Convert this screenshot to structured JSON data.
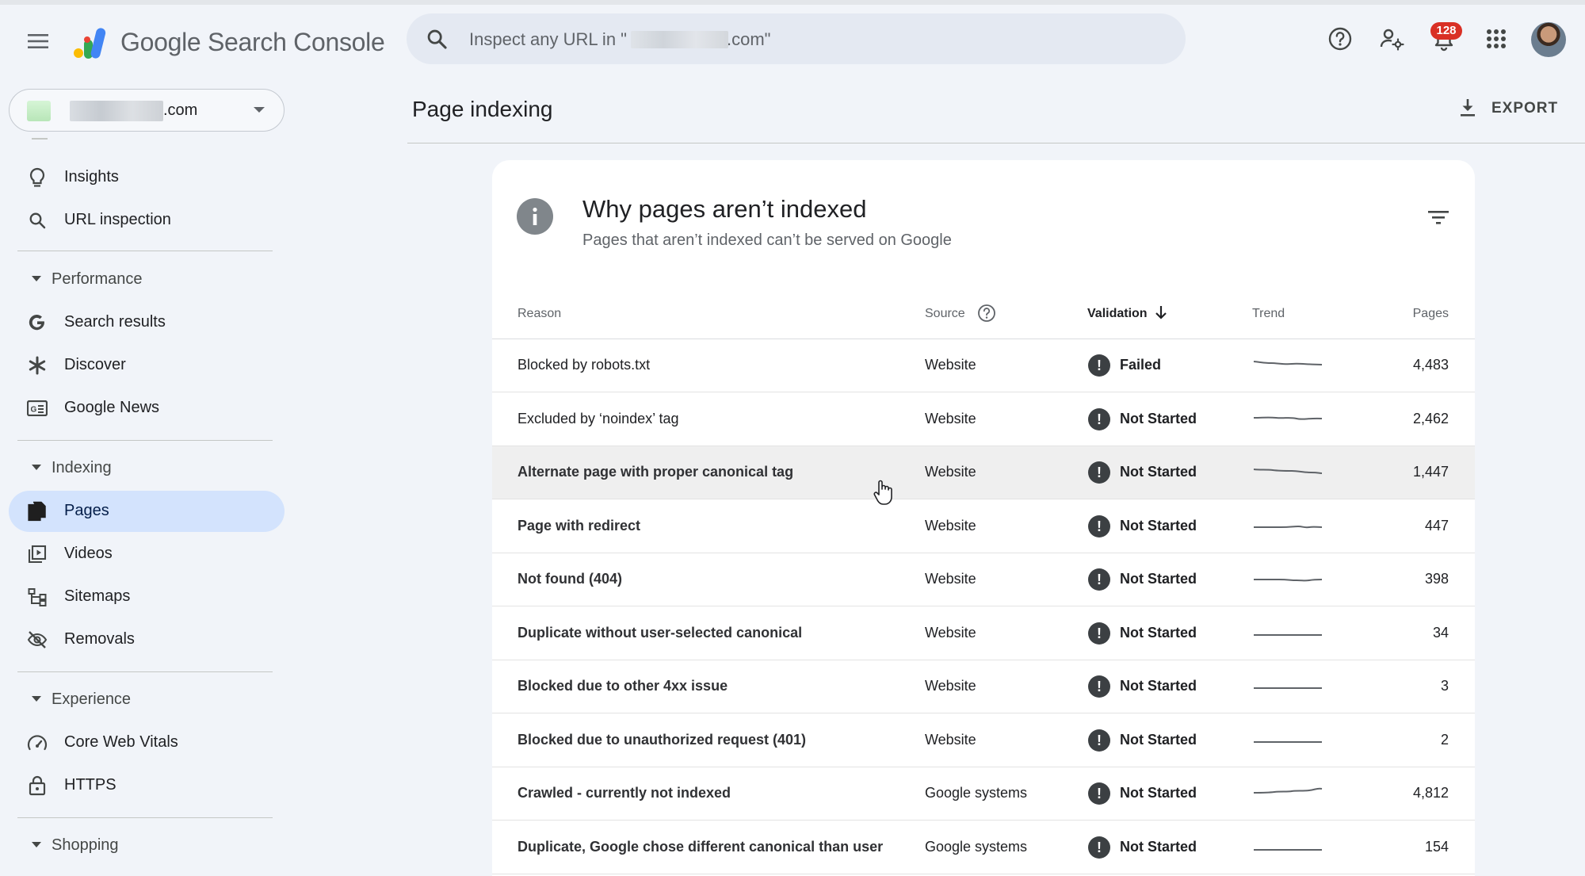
{
  "app": {
    "brand_google": "Google",
    "brand_product": "Search Console"
  },
  "search": {
    "placeholder": "Inspect any URL in \"",
    "placeholder_suffix": ".com\""
  },
  "header": {
    "notification_count": "128"
  },
  "property": {
    "suffix": ".com"
  },
  "sidebar": {
    "items": [
      {
        "label": "Insights",
        "icon": "lightbulb-icon"
      },
      {
        "label": "URL inspection",
        "icon": "search-icon"
      }
    ],
    "performance": {
      "label": "Performance",
      "items": [
        {
          "label": "Search results",
          "icon": "google-g-icon"
        },
        {
          "label": "Discover",
          "icon": "asterisk-icon"
        },
        {
          "label": "Google News",
          "icon": "news-icon"
        }
      ]
    },
    "indexing": {
      "label": "Indexing",
      "items": [
        {
          "label": "Pages",
          "icon": "pages-icon",
          "active": true
        },
        {
          "label": "Videos",
          "icon": "video-library-icon"
        },
        {
          "label": "Sitemaps",
          "icon": "sitemap-icon"
        },
        {
          "label": "Removals",
          "icon": "visibility-off-icon"
        }
      ]
    },
    "experience": {
      "label": "Experience",
      "items": [
        {
          "label": "Core Web Vitals",
          "icon": "speed-gauge-icon"
        },
        {
          "label": "HTTPS",
          "icon": "lock-icon"
        }
      ]
    },
    "shopping": {
      "label": "Shopping"
    }
  },
  "main": {
    "page_title": "Page indexing",
    "export_label": "EXPORT",
    "card": {
      "title": "Why pages aren’t indexed",
      "subtitle": "Pages that aren’t indexed can’t be served on Google"
    },
    "table": {
      "headers": {
        "reason": "Reason",
        "source": "Source",
        "validation": "Validation",
        "trend": "Trend",
        "pages": "Pages"
      },
      "rows": [
        {
          "reason": "Blocked by robots.txt",
          "source": "Website",
          "validation": "Failed",
          "pages": "4,483"
        },
        {
          "reason": "Excluded by ‘noindex’ tag",
          "source": "Website",
          "validation": "Not Started",
          "pages": "2,462"
        },
        {
          "reason": "Alternate page with proper canonical tag",
          "source": "Website",
          "validation": "Not Started",
          "pages": "1,447"
        },
        {
          "reason": "Page with redirect",
          "source": "Website",
          "validation": "Not Started",
          "pages": "447"
        },
        {
          "reason": "Not found (404)",
          "source": "Website",
          "validation": "Not Started",
          "pages": "398"
        },
        {
          "reason": "Duplicate without user-selected canonical",
          "source": "Website",
          "validation": "Not Started",
          "pages": "34"
        },
        {
          "reason": "Blocked due to other 4xx issue",
          "source": "Website",
          "validation": "Not Started",
          "pages": "3"
        },
        {
          "reason": "Blocked due to unauthorized request (401)",
          "source": "Website",
          "validation": "Not Started",
          "pages": "2"
        },
        {
          "reason": "Crawled - currently not indexed",
          "source": "Google systems",
          "validation": "Not Started",
          "pages": "4,812"
        },
        {
          "reason": "Duplicate, Google chose different canonical than user",
          "source": "Google systems",
          "validation": "Not Started",
          "pages": "154"
        }
      ]
    }
  },
  "colors": {
    "background": "#f1f4f9",
    "active_nav": "#d3e3fd",
    "badge": "#d93025",
    "status_icon": "#3c4043"
  }
}
